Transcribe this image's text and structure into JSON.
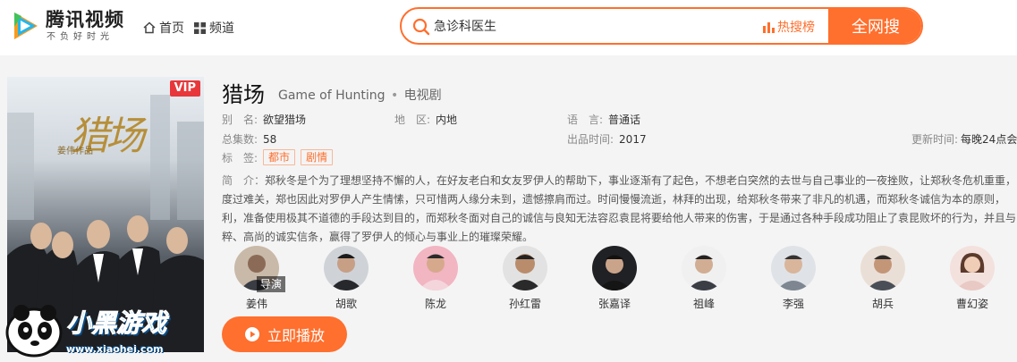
{
  "header": {
    "brand": "腾讯视频",
    "slogan": "不负好时光",
    "nav": [
      {
        "label": "首页"
      },
      {
        "label": "频道"
      }
    ],
    "search": {
      "value": "急诊科医生",
      "hot_label": "热搜榜",
      "button_label": "全网搜"
    }
  },
  "show": {
    "vip_badge": "VIP",
    "title": "猎场",
    "title_en": "Game of Hunting",
    "type": "电视剧",
    "alias_label": "别　名:",
    "alias": "欲望猎场",
    "region_label": "地　区:",
    "region": "内地",
    "language_label": "语　言:",
    "language": "普通话",
    "episodes_label": "总集数:",
    "episodes": "58",
    "year_label": "出品时间:",
    "year": "2017",
    "update_label": "更新时间:",
    "update": "每晚24点会",
    "tags_label": "标　签:",
    "tags": [
      "都市",
      "剧情"
    ],
    "desc_label": "简　介：",
    "description": "郑秋冬是个为了理想坚持不懈的人，在好友老白和女友罗伊人的帮助下，事业逐渐有了起色，不想老白突然的去世与自己事业的一夜挫败，让郑秋冬危机重重，度过难关，郑也因此对罗伊人产生情愫，只可惜两人缘分未到，遗憾擦肩而过。时间慢慢流逝，林拜的出现，给郑秋冬带来了非凡的机遇，而郑秋冬诚信为本的原则，利，准备使用极其不道德的手段达到目的，而郑秋冬面对自己的诚信与良知无法容忍袁昆将要给他人带来的伤害，于是通过各种手段成功阻止了袁昆败坏的行为，并且与粹、高尚的诚实信条，赢得了罗伊人的倾心与事业上的璀璨荣耀。",
    "poster_title": "猎场",
    "poster_sub": "姜伟作品"
  },
  "cast": [
    {
      "name": "姜伟",
      "role": "导演",
      "color": "#c9b9a8"
    },
    {
      "name": "胡歌",
      "role": "",
      "color": "#5a5f66"
    },
    {
      "name": "陈龙",
      "role": "",
      "color": "#e9a2b0"
    },
    {
      "name": "孙红雷",
      "role": "",
      "color": "#3f3b38"
    },
    {
      "name": "张嘉译",
      "role": "",
      "color": "#2e2e30"
    },
    {
      "name": "祖峰",
      "role": "",
      "color": "#d8d8d8"
    },
    {
      "name": "李强",
      "role": "",
      "color": "#bfc4c9"
    },
    {
      "name": "胡兵",
      "role": "",
      "color": "#c5a994"
    },
    {
      "name": "曹幻姿",
      "role": "",
      "color": "#e6c4c0"
    }
  ],
  "play_label": "立即播放",
  "watermark": {
    "text": "小黑游戏",
    "url_text": "www.xiaohei.com"
  },
  "colors": {
    "accent": "#ff6f2d",
    "vip": "#e8373a"
  }
}
